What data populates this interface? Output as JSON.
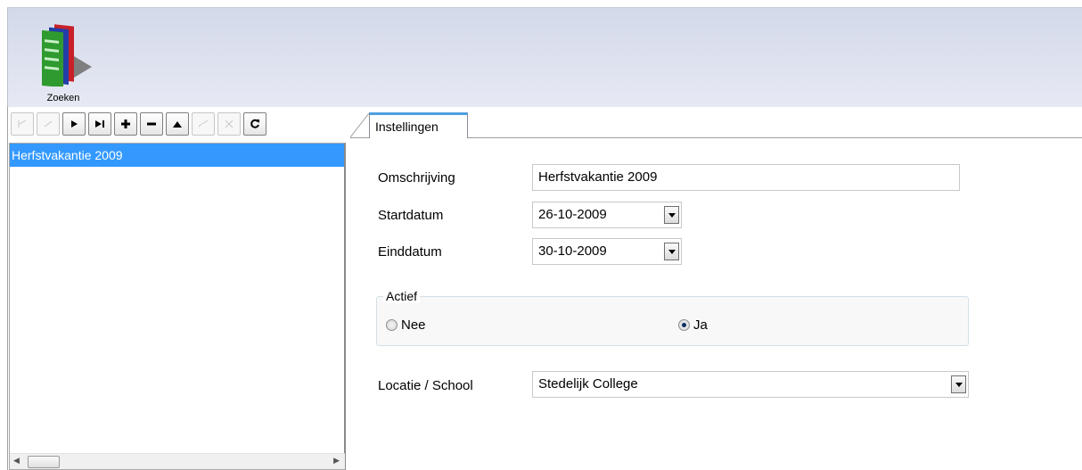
{
  "toolbar": {
    "zoeken_label": "Zoeken"
  },
  "nav": {
    "buttons": [
      {
        "name": "first-record-button",
        "glyph": "⇤",
        "enabled": false
      },
      {
        "name": "prior-record-button",
        "glyph": "⟵",
        "enabled": false
      },
      {
        "name": "next-record-button",
        "glyph": "▶",
        "enabled": true
      },
      {
        "name": "last-record-button",
        "glyph": "▶|",
        "enabled": true
      },
      {
        "name": "add-record-button",
        "glyph": "✚",
        "enabled": true
      },
      {
        "name": "delete-record-button",
        "glyph": "▬",
        "enabled": true
      },
      {
        "name": "edit-record-button",
        "glyph": "▲",
        "enabled": true
      },
      {
        "name": "post-record-button",
        "glyph": "✓",
        "enabled": false
      },
      {
        "name": "cancel-record-button",
        "glyph": "✕",
        "enabled": false
      },
      {
        "name": "refresh-button",
        "glyph": "↻",
        "enabled": true
      }
    ]
  },
  "list": {
    "items": [
      "Herfstvakantie 2009"
    ]
  },
  "tabs": {
    "active": "Instellingen"
  },
  "form": {
    "omschrijving_label": "Omschrijving",
    "omschrijving_value": "Herfstvakantie 2009",
    "startdatum_label": "Startdatum",
    "startdatum_value": "26-10-2009",
    "einddatum_label": "Einddatum",
    "einddatum_value": "30-10-2009",
    "actief_label": "Actief",
    "radio_nee": "Nee",
    "radio_ja": "Ja",
    "actief_selected": "Ja",
    "locatie_label": "Locatie / School",
    "locatie_value": "Stedelijk College"
  },
  "colors": {
    "selection": "#3399ff",
    "ribbon": "#d3d9ea",
    "tab_accent": "#4d9fe0"
  }
}
